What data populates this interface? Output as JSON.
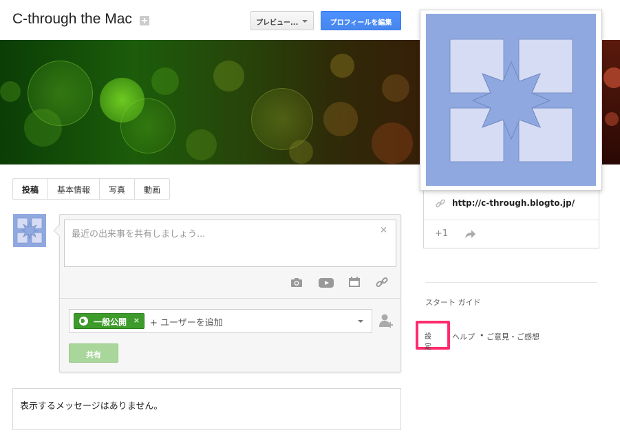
{
  "header": {
    "title": "C-through the Mac",
    "preview_label": "プレビュー...",
    "edit_profile_label": "プロフィールを編集"
  },
  "tabs": [
    {
      "label": "投稿",
      "active": true
    },
    {
      "label": "基本情報",
      "active": false
    },
    {
      "label": "写真",
      "active": false
    },
    {
      "label": "動画",
      "active": false
    }
  ],
  "share": {
    "placeholder": "最近の出来事を共有しましょう...",
    "close_symbol": "×",
    "tools": [
      "camera-icon",
      "video-icon",
      "event-icon",
      "link-icon"
    ],
    "audience_chip": "一般公開",
    "chip_remove": "×",
    "add_people": "+ ユーザーを追加",
    "share_button": "共有"
  },
  "stream": {
    "empty_message": "表示するメッセージはありません。"
  },
  "profile_card": {
    "link": "http://c-through.blogto.jp/",
    "plus_one": "+1"
  },
  "sidebar": {
    "start_guide": "スタート ガイド",
    "settings": "設定",
    "help": "ヘルプ",
    "separator": "•",
    "feedback": "ご意見・ご感想"
  },
  "colors": {
    "accent_blue": "#4d90fe",
    "public_green": "#3d9b2b",
    "highlight": "#ff2a6d",
    "avatar": "#8fa9e0"
  }
}
